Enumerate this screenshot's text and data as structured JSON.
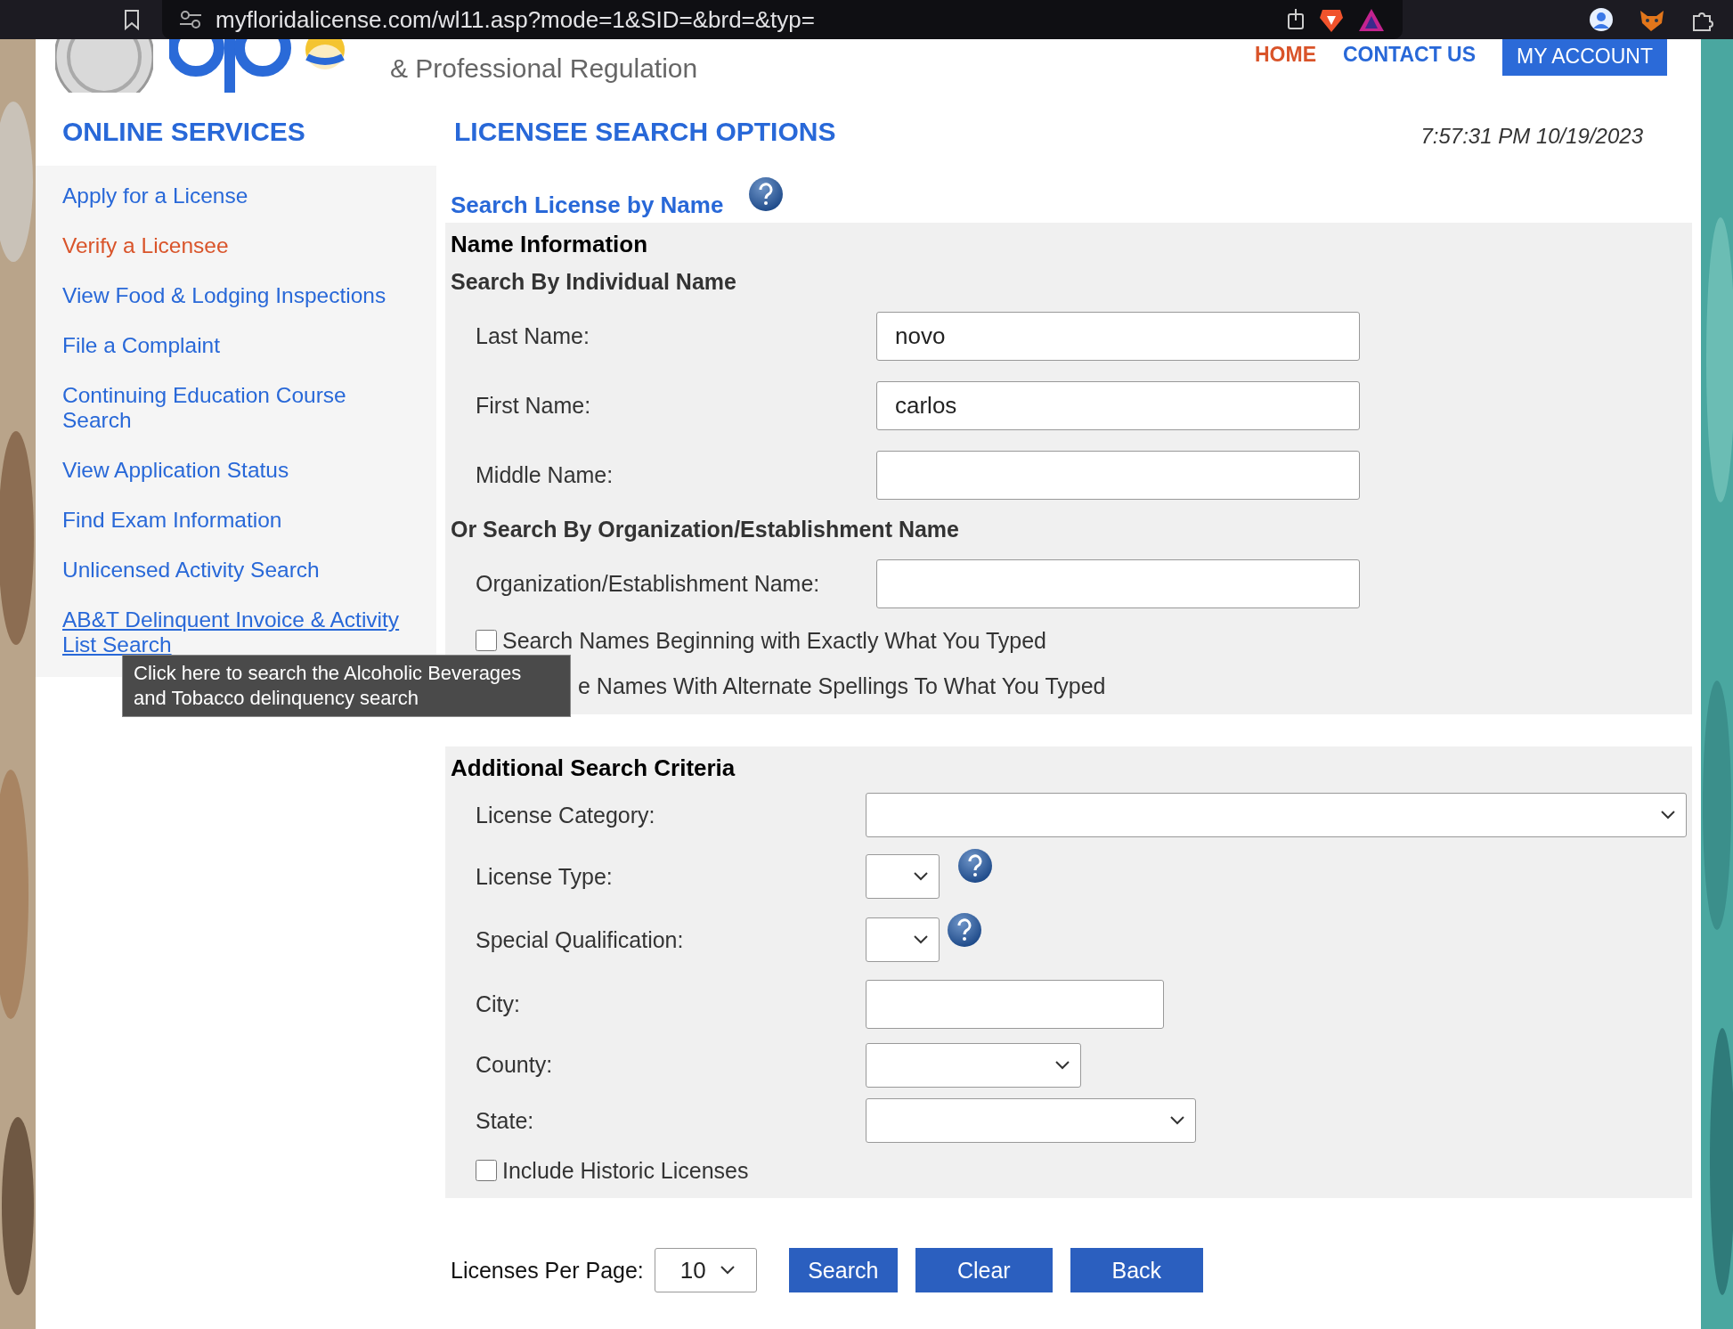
{
  "browser": {
    "url": "myfloridalicense.com/wl11.asp?mode=1&SID=&brd=&typ="
  },
  "header": {
    "agency": "& Professional Regulation",
    "nav": [
      {
        "label": "HOME",
        "kind": "link",
        "selected": true
      },
      {
        "label": "CONTACT US",
        "kind": "link",
        "selected": false
      },
      {
        "label": "MY ACCOUNT",
        "kind": "button",
        "selected": false
      }
    ]
  },
  "sidebar": {
    "title": "ONLINE SERVICES",
    "items": [
      {
        "label": "Apply for a License",
        "selected": false,
        "hovered": false
      },
      {
        "label": "Verify a Licensee",
        "selected": true,
        "hovered": false
      },
      {
        "label": "View Food & Lodging Inspections",
        "selected": false,
        "hovered": false
      },
      {
        "label": "File a Complaint",
        "selected": false,
        "hovered": false
      },
      {
        "label": "Continuing Education Course Search",
        "selected": false,
        "hovered": false
      },
      {
        "label": "View Application Status",
        "selected": false,
        "hovered": false
      },
      {
        "label": "Find Exam Information",
        "selected": false,
        "hovered": false
      },
      {
        "label": "Unlicensed Activity Search",
        "selected": false,
        "hovered": false
      },
      {
        "label": "AB&T Delinquent Invoice & Activity List Search",
        "selected": false,
        "hovered": true
      }
    ],
    "tooltip": "Click here to search the Alcoholic Beverages and Tobacco delinquency search"
  },
  "main": {
    "title": "LICENSEE SEARCH OPTIONS",
    "timestamp": "7:57:31 PM 10/19/2023",
    "section_title": "Search License by Name",
    "name_panel": {
      "title": "Name Information",
      "individual_heading": "Search By Individual Name",
      "fields": [
        {
          "label": "Last Name:",
          "value": "novo"
        },
        {
          "label": "First Name:",
          "value": "carlos"
        },
        {
          "label": "Middle Name:"
        }
      ],
      "org_heading": "Or Search By Organization/Establishment Name",
      "org_fields": [
        {
          "label": "Organization/Establishment Name:"
        }
      ],
      "options": [
        {
          "kind": "checkbox",
          "label": "Search Names Beginning with Exactly What You Typed",
          "checked": false
        },
        {
          "kind": "text",
          "label": "e Names With Alternate Spellings To What You Typed"
        }
      ]
    },
    "criteria": {
      "title": "Additional Search Criteria",
      "fields": [
        {
          "label": "License Category:",
          "kind": "select"
        },
        {
          "label": "License Type:",
          "kind": "select-help"
        },
        {
          "label": "Special Qualification:",
          "kind": "select-help"
        },
        {
          "label": "City:",
          "kind": "text"
        },
        {
          "label": "County:",
          "kind": "select"
        },
        {
          "label": "State:",
          "kind": "select"
        }
      ],
      "historic": {
        "label": "Include Historic Licenses",
        "checked": false
      }
    },
    "footer": {
      "per_page_label": "Licenses Per Page:",
      "per_page": "10",
      "buttons": [
        "Search",
        "Clear",
        "Back"
      ]
    }
  }
}
